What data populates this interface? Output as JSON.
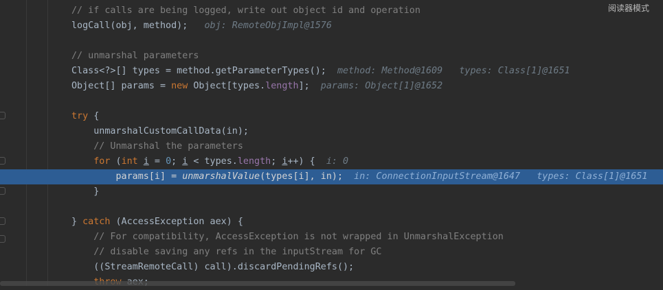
{
  "reader_mode": {
    "label": "阅读器模式"
  },
  "lines": [
    {
      "segments": [
        {
          "text": "// if calls are being logged, write out object id and operation",
          "cls": "cm"
        }
      ]
    },
    {
      "segments": [
        {
          "text": "logCall(obj, method);",
          "cls": ""
        },
        {
          "text": "   obj: RemoteObjImpl@1576",
          "cls": "hint"
        }
      ]
    },
    {
      "segments": []
    },
    {
      "segments": [
        {
          "text": "// unmarshal parameters",
          "cls": "cm"
        }
      ]
    },
    {
      "segments": [
        {
          "text": "Class<?>[] types = method.getParameterTypes();",
          "cls": ""
        },
        {
          "text": "  method: Method@1609   types: Class[1]@1651",
          "cls": "hint"
        }
      ]
    },
    {
      "segments": [
        {
          "text": "Object[] params = ",
          "cls": ""
        },
        {
          "text": "new",
          "cls": "kw"
        },
        {
          "text": " Object[types.",
          "cls": ""
        },
        {
          "text": "length",
          "cls": "fld"
        },
        {
          "text": "];",
          "cls": ""
        },
        {
          "text": "  params: Object[1]@1652",
          "cls": "hint"
        }
      ]
    },
    {
      "segments": []
    },
    {
      "segments": [
        {
          "text": "try",
          "cls": "kw"
        },
        {
          "text": " {",
          "cls": ""
        }
      ]
    },
    {
      "segments": [
        {
          "text": "    unmarshalCustomCallData(in);",
          "cls": ""
        }
      ]
    },
    {
      "segments": [
        {
          "text": "    // Unmarshal the parameters",
          "cls": "cm"
        }
      ]
    },
    {
      "segments": [
        {
          "text": "    ",
          "cls": ""
        },
        {
          "text": "for",
          "cls": "kw"
        },
        {
          "text": " (",
          "cls": ""
        },
        {
          "text": "int",
          "cls": "kw"
        },
        {
          "text": " ",
          "cls": ""
        },
        {
          "text": "i",
          "cls": "ul"
        },
        {
          "text": " = ",
          "cls": ""
        },
        {
          "text": "0",
          "cls": "num"
        },
        {
          "text": "; ",
          "cls": ""
        },
        {
          "text": "i",
          "cls": "ul"
        },
        {
          "text": " < types.",
          "cls": ""
        },
        {
          "text": "length",
          "cls": "fld"
        },
        {
          "text": "; ",
          "cls": ""
        },
        {
          "text": "i",
          "cls": "ul"
        },
        {
          "text": "++) {",
          "cls": ""
        },
        {
          "text": "  i: 0",
          "cls": "hint"
        }
      ]
    },
    {
      "exec": true,
      "segments": [
        {
          "text": "        params[i] = ",
          "cls": ""
        },
        {
          "text": "unmarshalValue",
          "cls": "it"
        },
        {
          "text": "(types[i], in);",
          "cls": ""
        },
        {
          "text": "  in: ConnectionInputStream@1647   types: Class[1]@1651",
          "cls": "hint"
        }
      ]
    },
    {
      "segments": [
        {
          "text": "    }",
          "cls": ""
        }
      ]
    },
    {
      "segments": []
    },
    {
      "segments": [
        {
          "text": "} ",
          "cls": ""
        },
        {
          "text": "catch",
          "cls": "kw"
        },
        {
          "text": " (AccessException aex) {",
          "cls": ""
        }
      ]
    },
    {
      "segments": [
        {
          "text": "    // For compatibility, AccessException is not wrapped in UnmarshalException",
          "cls": "cm"
        }
      ]
    },
    {
      "segments": [
        {
          "text": "    // disable saving any refs in the inputStream for GC",
          "cls": "cm"
        }
      ]
    },
    {
      "segments": [
        {
          "text": "    ((StreamRemoteCall) call).discardPendingRefs();",
          "cls": ""
        }
      ]
    },
    {
      "segments": [
        {
          "text": "    ",
          "cls": ""
        },
        {
          "text": "throw",
          "cls": "kw"
        },
        {
          "text": " aex;",
          "cls": ""
        }
      ]
    }
  ]
}
